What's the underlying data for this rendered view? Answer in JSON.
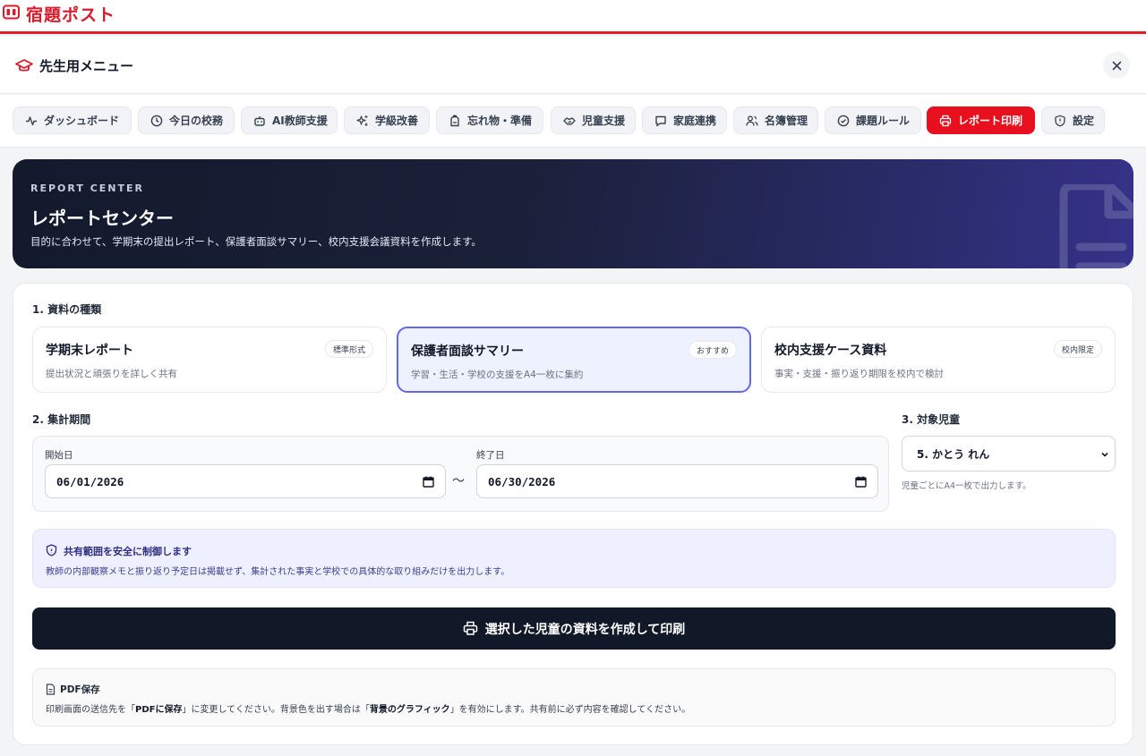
{
  "app": {
    "title": "宿題ポスト"
  },
  "menu": {
    "title": "先生用メニュー"
  },
  "tabs": [
    {
      "label": "ダッシュボード",
      "icon": "activity-icon"
    },
    {
      "label": "今日の校務",
      "icon": "clock-icon"
    },
    {
      "label": "AI教師支援",
      "icon": "robot-icon"
    },
    {
      "label": "学級改善",
      "icon": "sparkles-icon"
    },
    {
      "label": "忘れ物・準備",
      "icon": "backpack-icon"
    },
    {
      "label": "児童支援",
      "icon": "handshake-icon"
    },
    {
      "label": "家庭連携",
      "icon": "message-icon"
    },
    {
      "label": "名簿管理",
      "icon": "users-icon"
    },
    {
      "label": "課題ルール",
      "icon": "check-circle-icon"
    },
    {
      "label": "レポート印刷",
      "icon": "printer-icon",
      "active": true
    },
    {
      "label": "設定",
      "icon": "shield-icon"
    }
  ],
  "hero": {
    "eyebrow": "REPORT CENTER",
    "title": "レポートセンター",
    "description": "目的に合わせて、学期末の提出レポート、保護者面談サマリー、校内支援会議資料を作成します。"
  },
  "section1": {
    "label": "1. 資料の種類",
    "types": [
      {
        "title": "学期末レポート",
        "badge": "標準形式",
        "description": "提出状況と頑張りを詳しく共有"
      },
      {
        "title": "保護者面談サマリー",
        "badge": "おすすめ",
        "description": "学習・生活・学校の支援をA4一枚に集約",
        "selected": true
      },
      {
        "title": "校内支援ケース資料",
        "badge": "校内限定",
        "description": "事実・支援・振り返り期限を校内で検討"
      }
    ]
  },
  "section2": {
    "label": "2. 集計期間",
    "start_label": "開始日",
    "start_value": "06/01/2026",
    "separator": "〜",
    "end_label": "終了日",
    "end_value": "06/30/2026"
  },
  "section3": {
    "label": "3. 対象児童",
    "selected": "5. かとう れん",
    "note": "児童ごとにA4一枚で出力します。"
  },
  "notice": {
    "title": "共有範囲を安全に制御します",
    "text": "教師の内部観察メモと振り返り予定日は掲載せず、集計された事実と学校での具体的な取り組みだけを出力します。"
  },
  "print_button": {
    "label": "選択した児童の資料を作成して印刷"
  },
  "pdf": {
    "title": "PDF保存",
    "text_1": "印刷画面の送信先を「",
    "strong_1": "PDFに保存",
    "text_2": "」に変更してください。背景色を出す場合は「",
    "strong_2": "背景のグラフィック",
    "text_3": "」を有効にします。共有前に必ず内容を確認してください。"
  },
  "colors": {
    "brand": "#e11d2a",
    "active_tab": "#e8101f",
    "selected_border": "#6366f1",
    "primary_button": "#111827"
  }
}
